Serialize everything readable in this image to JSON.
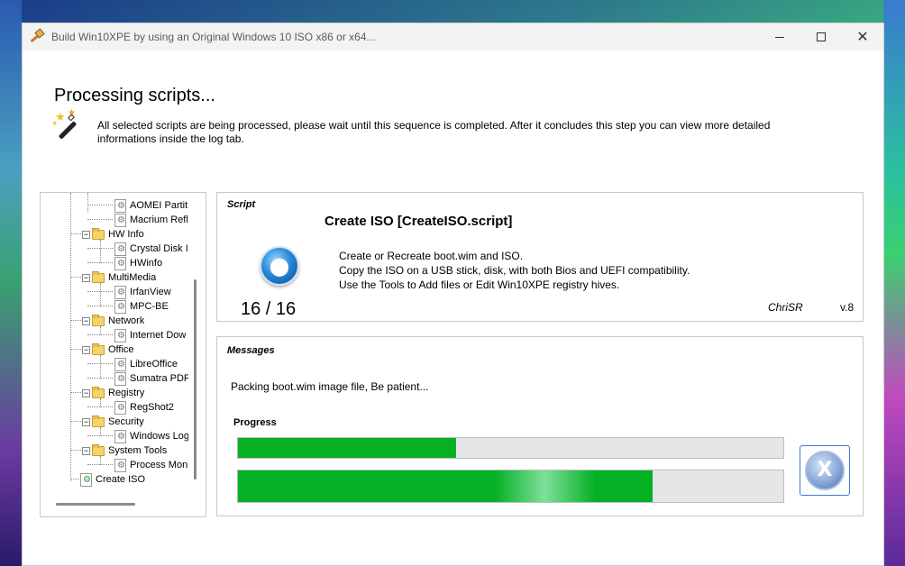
{
  "window": {
    "title": "Build Win10XPE by using an Original Windows 10 ISO x86 or x64...",
    "controls": {
      "minimize": "minimize-icon",
      "maximize": "maximize-icon",
      "close": "close-icon"
    }
  },
  "header": {
    "heading": "Processing scripts...",
    "description": "All selected scripts are being processed, please wait until this sequence is completed. After it concludes this step you can view more detailed informations inside the log tab."
  },
  "tree": {
    "items": [
      {
        "label": "AOMEI Partit",
        "type": "script"
      },
      {
        "label": "Macrium Refl",
        "type": "script"
      },
      {
        "label": "HW Info",
        "type": "folder"
      },
      {
        "label": "Crystal Disk I",
        "type": "script"
      },
      {
        "label": "HWinfo",
        "type": "script"
      },
      {
        "label": "MultiMedia",
        "type": "folder"
      },
      {
        "label": "IrfanView",
        "type": "script"
      },
      {
        "label": "MPC-BE",
        "type": "script"
      },
      {
        "label": "Network",
        "type": "folder"
      },
      {
        "label": "Internet Dow",
        "type": "script"
      },
      {
        "label": "Office",
        "type": "folder"
      },
      {
        "label": "LibreOffice",
        "type": "script"
      },
      {
        "label": "Sumatra PDF",
        "type": "script"
      },
      {
        "label": "Registry",
        "type": "folder"
      },
      {
        "label": "RegShot2",
        "type": "script"
      },
      {
        "label": "Security",
        "type": "folder"
      },
      {
        "label": "Windows Log",
        "type": "script"
      },
      {
        "label": "System Tools",
        "type": "folder"
      },
      {
        "label": "Process Moni",
        "type": "script"
      },
      {
        "label": "Create ISO",
        "type": "script"
      }
    ]
  },
  "script": {
    "caption": "Script",
    "title": "Create ISO [CreateISO.script]",
    "desc_line1": "Create or Recreate boot.wim and ISO.",
    "desc_line2": "Copy the ISO on a USB stick, disk, with both Bios and UEFI compatibility.",
    "desc_line3": "Use the Tools to Add files or Edit Win10XPE registry hives.",
    "counter": "16 / 16",
    "author": "ChriSR",
    "version": "v.8"
  },
  "messages": {
    "caption": "Messages",
    "text": "Packing boot.wim image file, Be patient...",
    "progress_label": "Progress",
    "progress_script": 0.4,
    "progress_total": 0.76,
    "cancel_icon": "cancel-icon",
    "cancel_glyph": "X"
  },
  "colors": {
    "progress_fill": "#06b025",
    "progress_track": "#e6e6e6",
    "cancel_border": "#3a7ad8"
  }
}
